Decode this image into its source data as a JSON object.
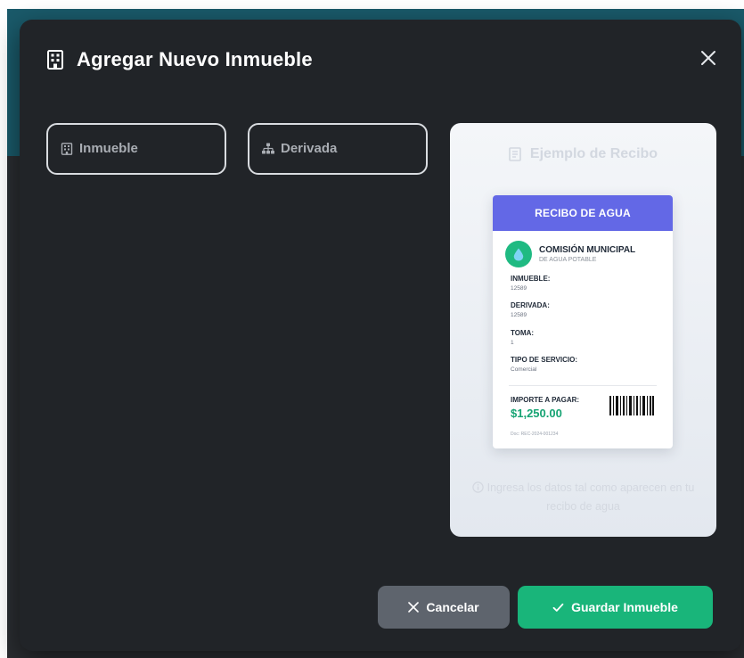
{
  "modal": {
    "title": "Agregar Nuevo Inmueble"
  },
  "fields": {
    "inmueble": {
      "label": "Inmueble"
    },
    "derivada": {
      "label": "Derivada"
    }
  },
  "example": {
    "title": "Ejemplo de Recibo",
    "receipt": {
      "header": "RECIBO DE AGUA",
      "org_name": "COMISIÓN MUNICIPAL",
      "org_sub": "DE AGUA POTABLE",
      "inmueble_label": "INMUEBLE:",
      "inmueble_value": "12589",
      "derivada_label": "DERIVADA:",
      "derivada_value": "12589",
      "toma_label": "TOMA:",
      "toma_value": "1",
      "servicio_label": "TIPO DE SERVICIO:",
      "servicio_value": "Comercial",
      "importe_label": "IMPORTE A PAGAR:",
      "importe_value": "$1,250.00",
      "doc_number": "Doc: REC-2024-001234"
    },
    "hint": "Ingresa los datos tal como aparecen en tu recibo de agua"
  },
  "actions": {
    "cancel_label": "Cancelar",
    "save_label": "Guardar Inmueble"
  },
  "colors": {
    "receipt_header": "#6368e6",
    "primary": "#19b57a",
    "secondary": "#5e646d"
  }
}
